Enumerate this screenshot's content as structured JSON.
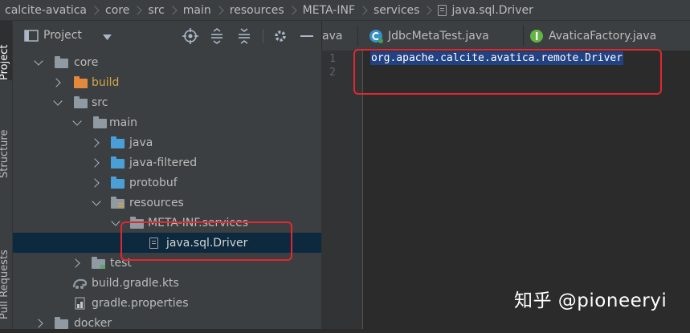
{
  "breadcrumb": {
    "items": [
      "calcite-avatica",
      "core",
      "src",
      "main",
      "resources",
      "META-INF",
      "services",
      "java.sql.Driver"
    ]
  },
  "toolstrip": {
    "tabs": [
      "Project",
      "Structure",
      "Pull Requests"
    ]
  },
  "project_panel": {
    "title": "Project",
    "tree": [
      {
        "label": "core",
        "icon": "module-folder-icon",
        "expanded": true
      },
      {
        "label": "build",
        "icon": "excluded-folder-icon",
        "expanded": false
      },
      {
        "label": "src",
        "icon": "folder-icon",
        "expanded": true
      },
      {
        "label": "main",
        "icon": "folder-icon",
        "expanded": true
      },
      {
        "label": "java",
        "icon": "source-folder-icon",
        "expanded": false
      },
      {
        "label": "java-filtered",
        "icon": "source-folder-icon",
        "expanded": false
      },
      {
        "label": "protobuf",
        "icon": "source-folder-icon",
        "expanded": false
      },
      {
        "label": "resources",
        "icon": "resources-folder-icon",
        "expanded": true
      },
      {
        "label": "META-INF.services",
        "icon": "folder-icon",
        "expanded": true
      },
      {
        "label": "java.sql.Driver",
        "icon": "text-file-icon",
        "selected": true
      },
      {
        "label": "test",
        "icon": "test-folder-icon",
        "expanded": false
      },
      {
        "label": "build.gradle.kts",
        "icon": "gradle-icon"
      },
      {
        "label": "gradle.properties",
        "icon": "properties-file-icon"
      },
      {
        "label": "docker",
        "icon": "folder-icon",
        "expanded": false
      }
    ]
  },
  "editor": {
    "tabs": [
      {
        "label": "ava",
        "icon": ""
      },
      {
        "label": "JdbcMetaTest.java",
        "icon": "java-class-icon"
      },
      {
        "label": "AvaticaFactory.java",
        "icon": "java-interface-icon"
      }
    ],
    "line_numbers": [
      "1",
      "2"
    ],
    "lines": [
      "org.apache.calcite.avatica.remote.Driver",
      ""
    ]
  },
  "watermark": "知乎 @pioneeryi",
  "colors": {
    "background": "#2b2b2b",
    "panel": "#3c3f41",
    "selection": "#0d293e",
    "highlight": "#214283",
    "annotation": "#e3272e",
    "excluded_folder": "#e2893c",
    "source_folder": "#4a9fd8"
  }
}
